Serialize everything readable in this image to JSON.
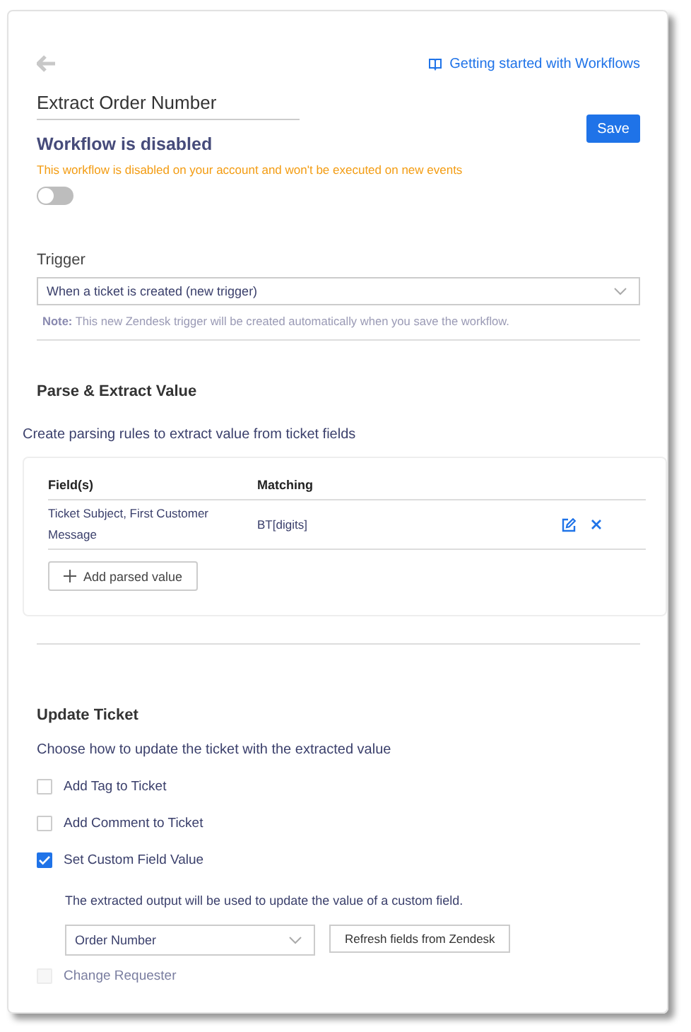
{
  "header": {
    "help_link": "Getting started with Workflows"
  },
  "workflow": {
    "name": "Extract Order Number",
    "save_label": "Save",
    "status_title": "Workflow is disabled",
    "status_message": "This workflow is disabled on your account and won't be executed on new events",
    "enabled": false
  },
  "trigger": {
    "label": "Trigger",
    "value": "When a ticket is created (new trigger)",
    "note": "**Note:** This new Zendesk trigger will be created automatically when you save the workflow."
  },
  "parse": {
    "title": "Parse & Extract Value",
    "description": "Create parsing rules to extract value from ticket fields",
    "columns": [
      "Field(s)",
      "Matching"
    ],
    "rows": [
      {
        "fields": "Ticket Subject, First Customer Message",
        "matching": "BT[digits]"
      }
    ],
    "add_label": "Add parsed value"
  },
  "update": {
    "title": "Update Ticket",
    "description": "Choose how to update the ticket with the extracted value",
    "options": [
      {
        "label": "Add Tag to Ticket",
        "checked": false,
        "disabled": false
      },
      {
        "label": "Add Comment to Ticket",
        "checked": false,
        "disabled": false
      },
      {
        "label": "Set Custom Field Value",
        "checked": true,
        "disabled": false,
        "details": {
          "text": "The extracted output will be used to update the value of a custom field.",
          "field_value": "Order Number",
          "refresh_label": "Refresh fields from Zendesk"
        }
      },
      {
        "label": "Change Requester",
        "checked": false,
        "disabled": true
      }
    ]
  }
}
